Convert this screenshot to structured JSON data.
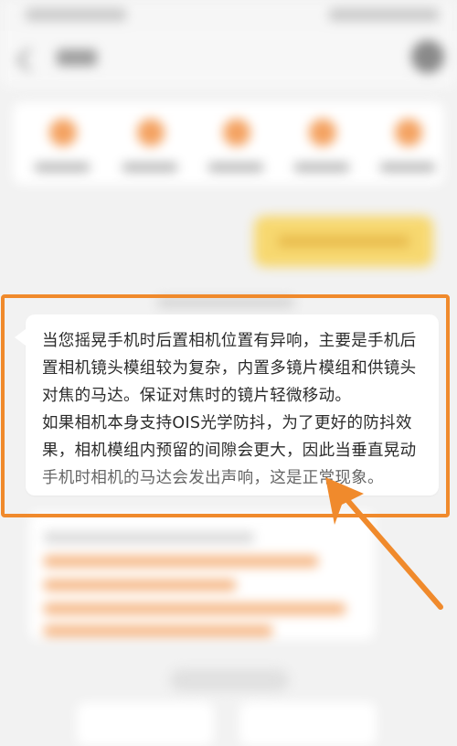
{
  "message": {
    "lines": [
      "当您摇晃手机时后置相机位置有异响，主要是手机后",
      "置相机镜头模组较为复杂，内置多镜片模组和供镜头",
      "对焦的马达。保证对焦时的镜片轻微移动。",
      "如果相机本身支持OIS光学防抖，为了更好的防抖效",
      "果，相机模组内预留的间隙会更大，因此当垂直晃动",
      "手机时相机的马达会发出声响，这是正常现象。"
    ]
  },
  "colors": {
    "highlight": "#f08a2c",
    "background": "#f2f2f2",
    "card": "#ffffff",
    "accent_yellow": "#f7d870"
  },
  "icons": [
    "back-icon",
    "avatar",
    "arrow-pointer-icon"
  ]
}
